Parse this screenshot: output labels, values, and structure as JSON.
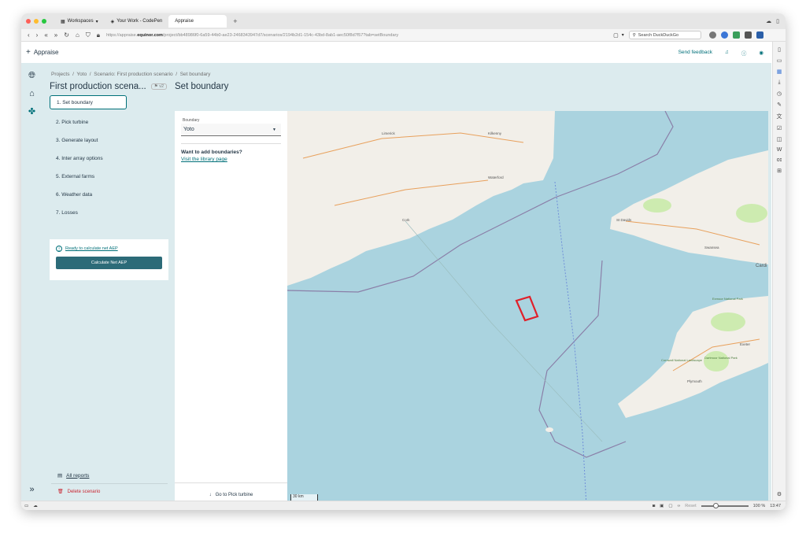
{
  "browser": {
    "tabs": [
      {
        "label": "Workspaces",
        "icon": "grid-icon"
      },
      {
        "label": "Your Work - CodePen",
        "icon": "codepen-icon"
      },
      {
        "label": "Appraise",
        "icon": ""
      }
    ],
    "url_prefix": "https://appraise.",
    "url_host": "equinor.com",
    "url_path": "/project/bb48986f0-6a59-44b0-ae23-2468343947d7/scenarios/2194b2d1-154c-43bd-8ab1-aec50f8d7f57?tab=setBoundary",
    "search_placeholder": "Search DuckDuckGo",
    "zoom_reset": "Reset",
    "zoom_value": "100 %",
    "time": "13:47",
    "zoom_level": 0.25
  },
  "app": {
    "name": "Appraise",
    "send_feedback": "Send feedback"
  },
  "breadcrumb": [
    "Projects",
    "Yoto",
    "Scenario: First production scenario",
    "Set boundary"
  ],
  "scenario": {
    "title": "First production scena...",
    "version": "v2"
  },
  "page_title": "Set boundary",
  "steps": [
    "1. Set boundary",
    "2. Pick turbine",
    "3. Generate layout",
    "4. Inter array options",
    "5. External farms",
    "6. Weather data",
    "7. Losses"
  ],
  "calc": {
    "ready_text": "Ready to calculate net AEP",
    "button": "Calculate Net AEP"
  },
  "bottom_links": {
    "reports": "All reports",
    "delete": "Delete scenario"
  },
  "boundary": {
    "label": "Boundary",
    "value": "Yoto",
    "want_title": "Want to add boundaries?",
    "visit_link": "Visit the library page",
    "goto": "Go to Pick turbine"
  },
  "map": {
    "scale": "30 km",
    "place_labels": [
      "Limerick",
      "Kilkenny",
      "Waterford",
      "Cork",
      "St Davids",
      "Swansea",
      "Cardi",
      "Exmoor National Park",
      "Exeter",
      "Dartmoor National Park",
      "Cornwall National Landscape",
      "Plymouth"
    ]
  },
  "colors": {
    "accent": "#007079",
    "button": "#2c6b78",
    "danger": "#c92632",
    "sea": "#aad3df",
    "land": "#f2efe9",
    "boundary": "#e0202a",
    "app_bg": "#dcebee"
  }
}
